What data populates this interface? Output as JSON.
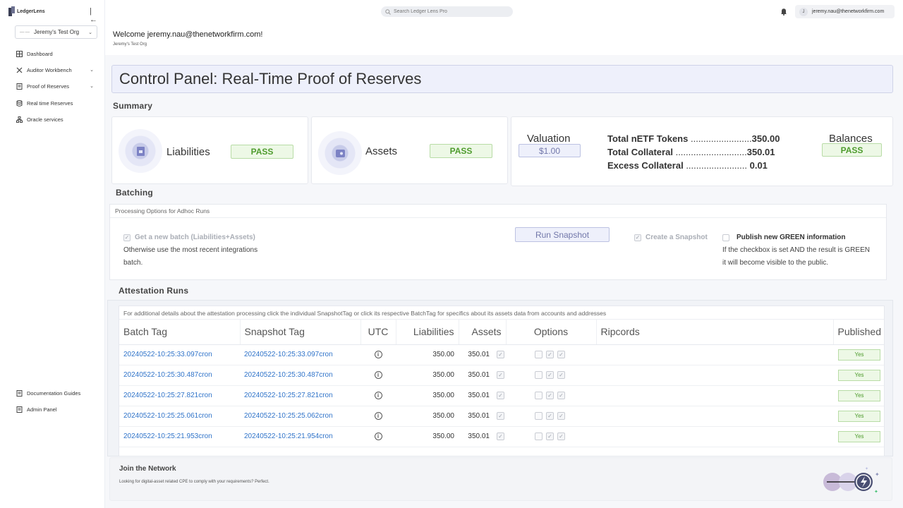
{
  "brand": {
    "name": "LedgerLens"
  },
  "sidebar": {
    "org": "Jeremy's Test Org",
    "items": [
      {
        "label": "Dashboard",
        "icon": "grid-icon",
        "expandable": false
      },
      {
        "label": "Auditor Workbench",
        "icon": "tools-icon",
        "expandable": true
      },
      {
        "label": "Proof of Reserves",
        "icon": "document-icon",
        "expandable": true
      },
      {
        "label": "Real time Reserves",
        "icon": "database-icon",
        "expandable": false
      },
      {
        "label": "Oracle services",
        "icon": "network-icon",
        "expandable": false
      }
    ],
    "bottom_items": [
      {
        "label": "Documentation Guides",
        "icon": "document-icon"
      },
      {
        "label": "Admin Panel",
        "icon": "document-icon"
      }
    ]
  },
  "header": {
    "search_placeholder": "Search Ledger Lens Pro",
    "user_initial": "J",
    "user_email": "jeremy.nau@thenetworkfirm.com"
  },
  "welcome": {
    "message": "Welcome jeremy.nau@thenetworkfirm.com!",
    "org": "Jeremy's Test Org"
  },
  "page_title": "Control Panel: Real-Time Proof of Reserves",
  "summary": {
    "label": "Summary",
    "liabilities": {
      "label": "Liabilities",
      "status": "PASS"
    },
    "assets": {
      "label": "Assets",
      "status": "PASS"
    },
    "valuation": {
      "label": "Valuation",
      "value": "$1.00"
    },
    "totals": [
      {
        "label": "Total nETF Tokens",
        "dots": "........................",
        "value": "350.00"
      },
      {
        "label": "Total Collateral",
        "dots": "............................",
        "value": "350.01"
      },
      {
        "label": "Excess Collateral",
        "dots": "........................",
        "value": " 0.01"
      }
    ],
    "balances": {
      "label": "Balances",
      "status": "PASS"
    }
  },
  "batching": {
    "label": "Batching",
    "header": "Processing Options for Adhoc Runs",
    "get_batch_label": "Get a new batch (Liabilities+Assets)",
    "get_batch_help_1": "Otherwise use the most recent integrations",
    "get_batch_help_2": "batch.",
    "run_button": "Run Snapshot",
    "create_snapshot_label": "Create a Snapshot",
    "publish_label": "Publish new GREEN information",
    "publish_help_1": "If the checkbox is set AND the result is GREEN",
    "publish_help_2": "it will become visible to the public."
  },
  "attestation": {
    "label": "Attestation Runs",
    "note": "For additional details about the attestation processing click the individual SnapshotTag or click its respective BatchTag for specifics about its assets data from accounts and addresses",
    "columns": [
      "Batch Tag",
      "Snapshot Tag",
      "UTC",
      "Liabilities",
      "Assets",
      "Options",
      "Ripcords",
      "Published"
    ],
    "rows": [
      {
        "batch": "20240522-10:25:33.097cron",
        "snapshot": "20240522-10:25:33.097cron",
        "liabilities": "350.00",
        "assets": "350.01",
        "published": "Yes"
      },
      {
        "batch": "20240522-10:25:30.487cron",
        "snapshot": "20240522-10:25:30.487cron",
        "liabilities": "350.00",
        "assets": "350.01",
        "published": "Yes"
      },
      {
        "batch": "20240522-10:25:27.821cron",
        "snapshot": "20240522-10:25:27.821cron",
        "liabilities": "350.00",
        "assets": "350.01",
        "published": "Yes"
      },
      {
        "batch": "20240522-10:25:25.061cron",
        "snapshot": "20240522-10:25:25.062cron",
        "liabilities": "350.00",
        "assets": "350.01",
        "published": "Yes"
      },
      {
        "batch": "20240522-10:25:21.953cron",
        "snapshot": "20240522-10:25:21.954cron",
        "liabilities": "350.00",
        "assets": "350.01",
        "published": "Yes"
      }
    ]
  },
  "join": {
    "title": "Join the Network",
    "subtitle": "Looking for digital-asset related CPE to comply with your requirements? Perfect."
  },
  "colors": {
    "pass_green": "#4f9c2e",
    "accent": "#7277aa",
    "link": "#2f73c9"
  }
}
